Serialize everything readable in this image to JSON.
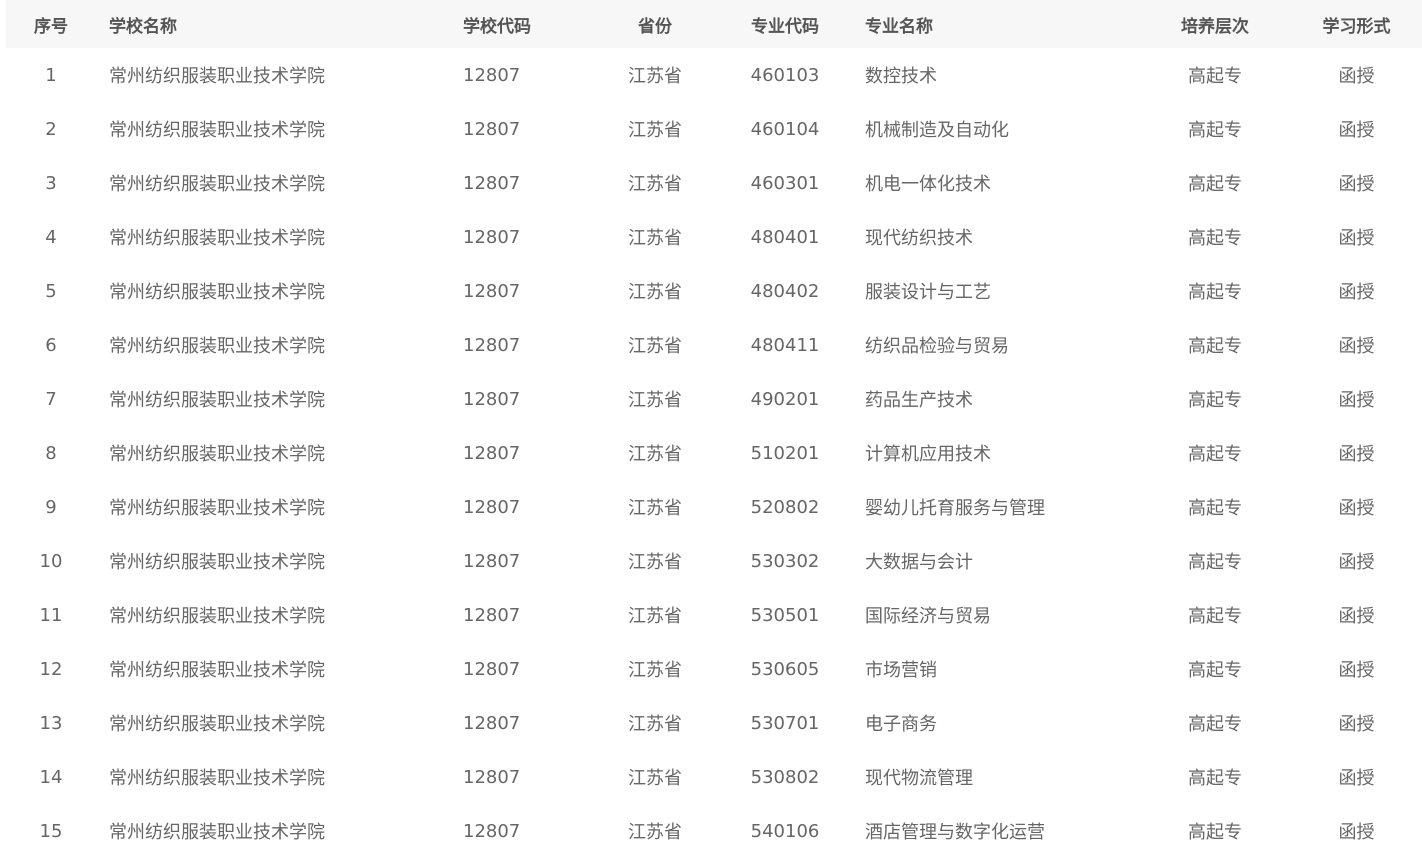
{
  "table": {
    "headers": {
      "index": "序号",
      "school_name": "学校名称",
      "school_code": "学校代码",
      "province": "省份",
      "major_code": "专业代码",
      "major_name": "专业名称",
      "level": "培养层次",
      "study_form": "学习形式"
    },
    "rows": [
      {
        "index": "1",
        "school_name": "常州纺织服装职业技术学院",
        "school_code": "12807",
        "province": "江苏省",
        "major_code": "460103",
        "major_name": "数控技术",
        "level": "高起专",
        "study_form": "函授"
      },
      {
        "index": "2",
        "school_name": "常州纺织服装职业技术学院",
        "school_code": "12807",
        "province": "江苏省",
        "major_code": "460104",
        "major_name": "机械制造及自动化",
        "level": "高起专",
        "study_form": "函授"
      },
      {
        "index": "3",
        "school_name": "常州纺织服装职业技术学院",
        "school_code": "12807",
        "province": "江苏省",
        "major_code": "460301",
        "major_name": "机电一体化技术",
        "level": "高起专",
        "study_form": "函授"
      },
      {
        "index": "4",
        "school_name": "常州纺织服装职业技术学院",
        "school_code": "12807",
        "province": "江苏省",
        "major_code": "480401",
        "major_name": "现代纺织技术",
        "level": "高起专",
        "study_form": "函授"
      },
      {
        "index": "5",
        "school_name": "常州纺织服装职业技术学院",
        "school_code": "12807",
        "province": "江苏省",
        "major_code": "480402",
        "major_name": "服装设计与工艺",
        "level": "高起专",
        "study_form": "函授"
      },
      {
        "index": "6",
        "school_name": "常州纺织服装职业技术学院",
        "school_code": "12807",
        "province": "江苏省",
        "major_code": "480411",
        "major_name": "纺织品检验与贸易",
        "level": "高起专",
        "study_form": "函授"
      },
      {
        "index": "7",
        "school_name": "常州纺织服装职业技术学院",
        "school_code": "12807",
        "province": "江苏省",
        "major_code": "490201",
        "major_name": "药品生产技术",
        "level": "高起专",
        "study_form": "函授"
      },
      {
        "index": "8",
        "school_name": "常州纺织服装职业技术学院",
        "school_code": "12807",
        "province": "江苏省",
        "major_code": "510201",
        "major_name": "计算机应用技术",
        "level": "高起专",
        "study_form": "函授"
      },
      {
        "index": "9",
        "school_name": "常州纺织服装职业技术学院",
        "school_code": "12807",
        "province": "江苏省",
        "major_code": "520802",
        "major_name": "婴幼儿托育服务与管理",
        "level": "高起专",
        "study_form": "函授"
      },
      {
        "index": "10",
        "school_name": "常州纺织服装职业技术学院",
        "school_code": "12807",
        "province": "江苏省",
        "major_code": "530302",
        "major_name": "大数据与会计",
        "level": "高起专",
        "study_form": "函授"
      },
      {
        "index": "11",
        "school_name": "常州纺织服装职业技术学院",
        "school_code": "12807",
        "province": "江苏省",
        "major_code": "530501",
        "major_name": "国际经济与贸易",
        "level": "高起专",
        "study_form": "函授"
      },
      {
        "index": "12",
        "school_name": "常州纺织服装职业技术学院",
        "school_code": "12807",
        "province": "江苏省",
        "major_code": "530605",
        "major_name": "市场营销",
        "level": "高起专",
        "study_form": "函授"
      },
      {
        "index": "13",
        "school_name": "常州纺织服装职业技术学院",
        "school_code": "12807",
        "province": "江苏省",
        "major_code": "530701",
        "major_name": "电子商务",
        "level": "高起专",
        "study_form": "函授"
      },
      {
        "index": "14",
        "school_name": "常州纺织服装职业技术学院",
        "school_code": "12807",
        "province": "江苏省",
        "major_code": "530802",
        "major_name": "现代物流管理",
        "level": "高起专",
        "study_form": "函授"
      },
      {
        "index": "15",
        "school_name": "常州纺织服装职业技术学院",
        "school_code": "12807",
        "province": "江苏省",
        "major_code": "540106",
        "major_name": "酒店管理与数字化运营",
        "level": "高起专",
        "study_form": "函授"
      }
    ]
  }
}
